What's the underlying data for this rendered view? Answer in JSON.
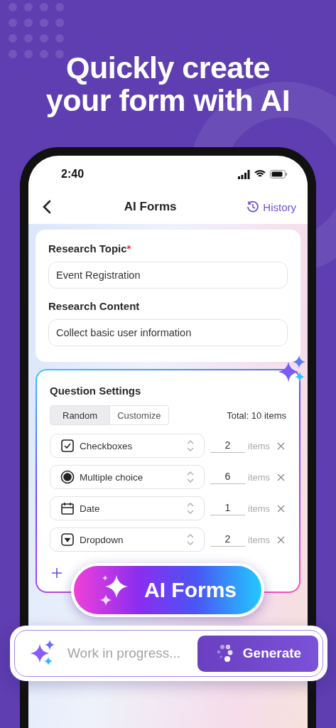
{
  "headline": [
    "Quickly create",
    "your form with AI"
  ],
  "status_bar": {
    "time": "2:40"
  },
  "nav": {
    "title": "AI Forms",
    "action": "History"
  },
  "topic_card": {
    "required_marker": "*",
    "fields": [
      {
        "label": "Research Topic",
        "required": true,
        "value": "Event Registration"
      },
      {
        "label": "Research Content",
        "required": false,
        "value": "Collect basic user information"
      }
    ]
  },
  "question_settings": {
    "title": "Question Settings",
    "modes": [
      {
        "label": "Random",
        "selected": true
      },
      {
        "label": "Customize",
        "selected": false
      }
    ],
    "total": "Total: 10 items",
    "rows": [
      {
        "kind": "checkbox",
        "label": "Checkboxes",
        "count": "2",
        "unit": "items"
      },
      {
        "kind": "radio",
        "label": "Multiple choice",
        "count": "6",
        "unit": "items"
      },
      {
        "kind": "date",
        "label": "Date",
        "count": "1",
        "unit": "items"
      },
      {
        "kind": "dropdown",
        "label": "Dropdown",
        "count": "2",
        "unit": "items"
      }
    ]
  },
  "ai_badge": {
    "label": "AI Forms"
  },
  "prompt_bar": {
    "placeholder": "Work in progress...",
    "button": "Generate"
  }
}
